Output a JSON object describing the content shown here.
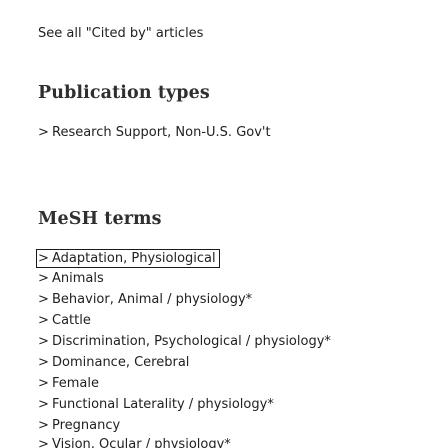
{
  "cited_by_link": "See all \"Cited by\" articles",
  "publication_types": {
    "heading": "Publication types",
    "items": [
      {
        "label": "Research Support, Non-U.S. Gov't"
      }
    ]
  },
  "mesh_terms": {
    "heading": "MeSH terms",
    "items": [
      {
        "label": "Adaptation, Physiological"
      },
      {
        "label": "Animals"
      },
      {
        "label": "Behavior, Animal / physiology*"
      },
      {
        "label": "Cattle"
      },
      {
        "label": "Discrimination, Psychological / physiology*"
      },
      {
        "label": "Dominance, Cerebral"
      },
      {
        "label": "Female"
      },
      {
        "label": "Functional Laterality / physiology*"
      },
      {
        "label": "Pregnancy"
      },
      {
        "label": "Vision, Ocular / physiology*"
      }
    ]
  },
  "icons": {
    "chevron": "chevron-right-icon",
    "chevron_glyph": ">"
  }
}
